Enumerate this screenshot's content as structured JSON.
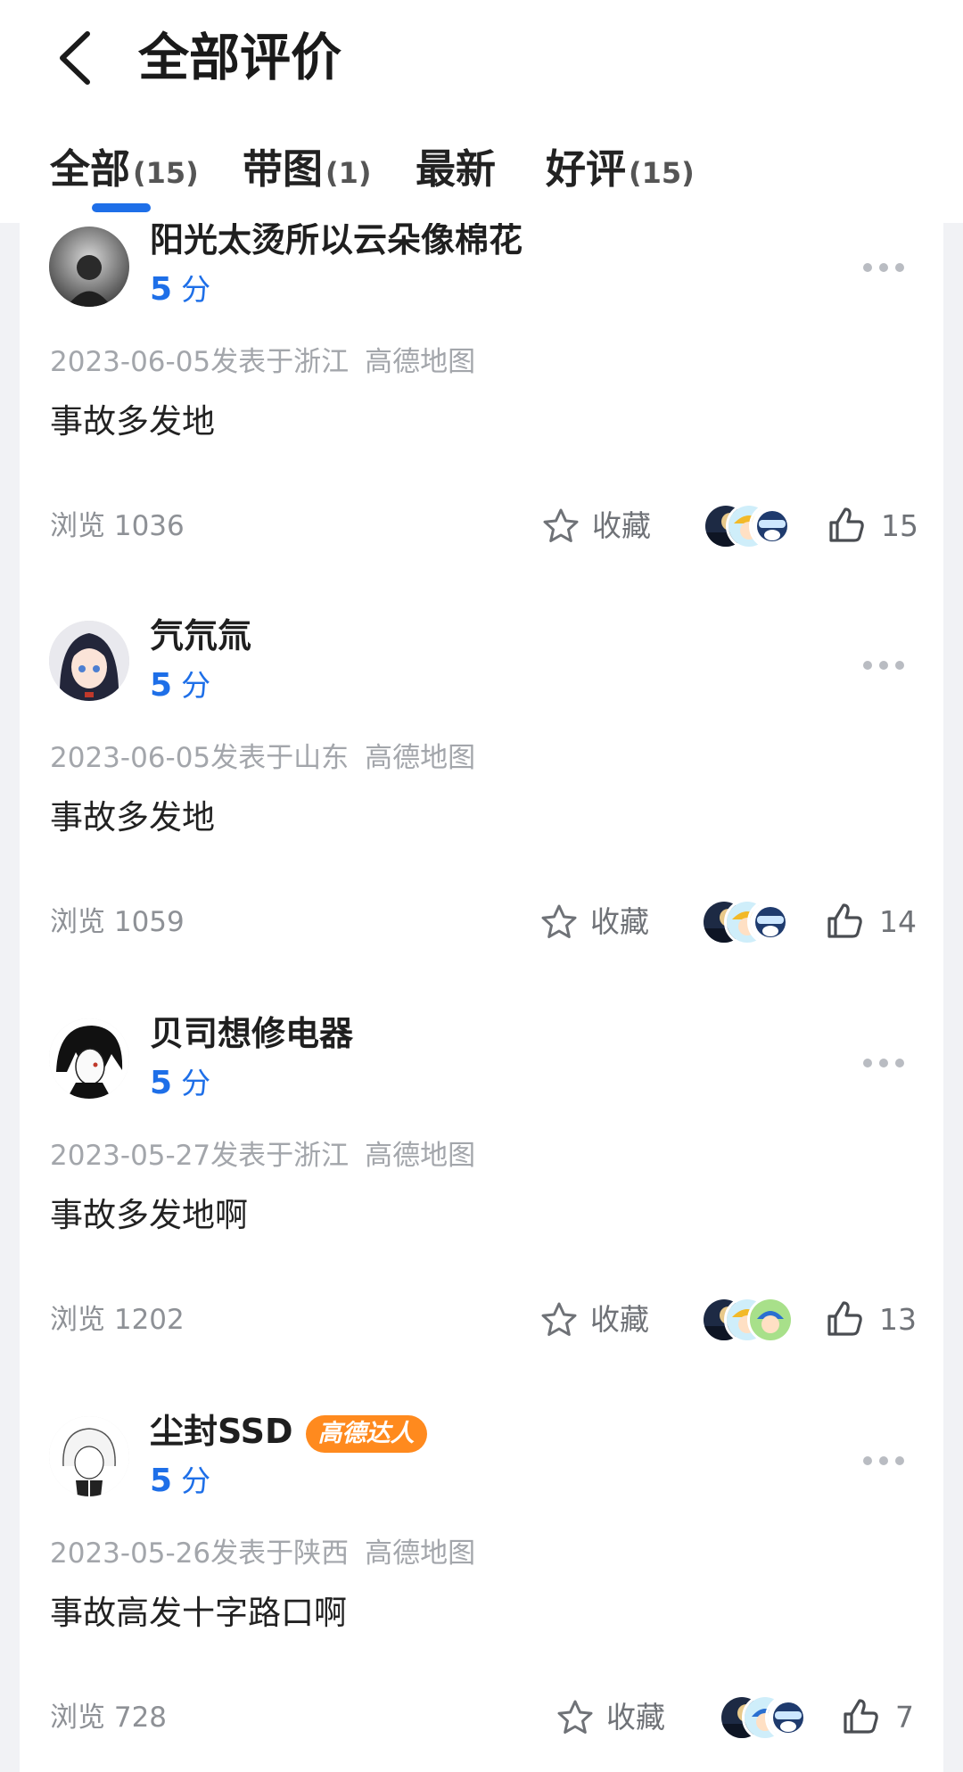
{
  "header": {
    "title": "全部评价",
    "back_icon": "chevron-left-icon"
  },
  "tabs": [
    {
      "label": "全部",
      "count": "(15)",
      "active": true
    },
    {
      "label": "带图",
      "count": "(1)",
      "active": false
    },
    {
      "label": "最新",
      "count": "",
      "active": false
    },
    {
      "label": "好评",
      "count": "(15)",
      "active": false
    }
  ],
  "colors": {
    "accent": "#1e6fe8",
    "badge": "#ff8a1e",
    "meta_text": "#a3a6ab",
    "background": "#f1f2f5"
  },
  "reviews": [
    {
      "username": "阳光太烫所以云朵像棉花",
      "score": "5",
      "score_unit": "分",
      "date": "2023-06-05",
      "location": "发表于浙江",
      "source": "高德地图",
      "text": "事故多发地",
      "views": "浏览 1036",
      "favorite_label": "收藏",
      "likes": "15"
    },
    {
      "username": "氕氘氚",
      "score": "5",
      "score_unit": "分",
      "date": "2023-06-05",
      "location": "发表于山东",
      "source": "高德地图",
      "text": "事故多发地",
      "views": "浏览 1059",
      "favorite_label": "收藏",
      "likes": "14"
    },
    {
      "username": "贝司想修电器",
      "score": "5",
      "score_unit": "分",
      "date": "2023-05-27",
      "location": "发表于浙江",
      "source": "高德地图",
      "text": "事故多发地啊",
      "views": "浏览 1202",
      "favorite_label": "收藏",
      "likes": "13"
    },
    {
      "username": "尘封SSD",
      "badge": "高德达人",
      "score": "5",
      "score_unit": "分",
      "date": "2023-05-26",
      "location": "发表于陕西",
      "source": "高德地图",
      "text": "事故高发十字路口啊",
      "views": "浏览 728",
      "favorite_label": "收藏",
      "likes": "7"
    }
  ]
}
